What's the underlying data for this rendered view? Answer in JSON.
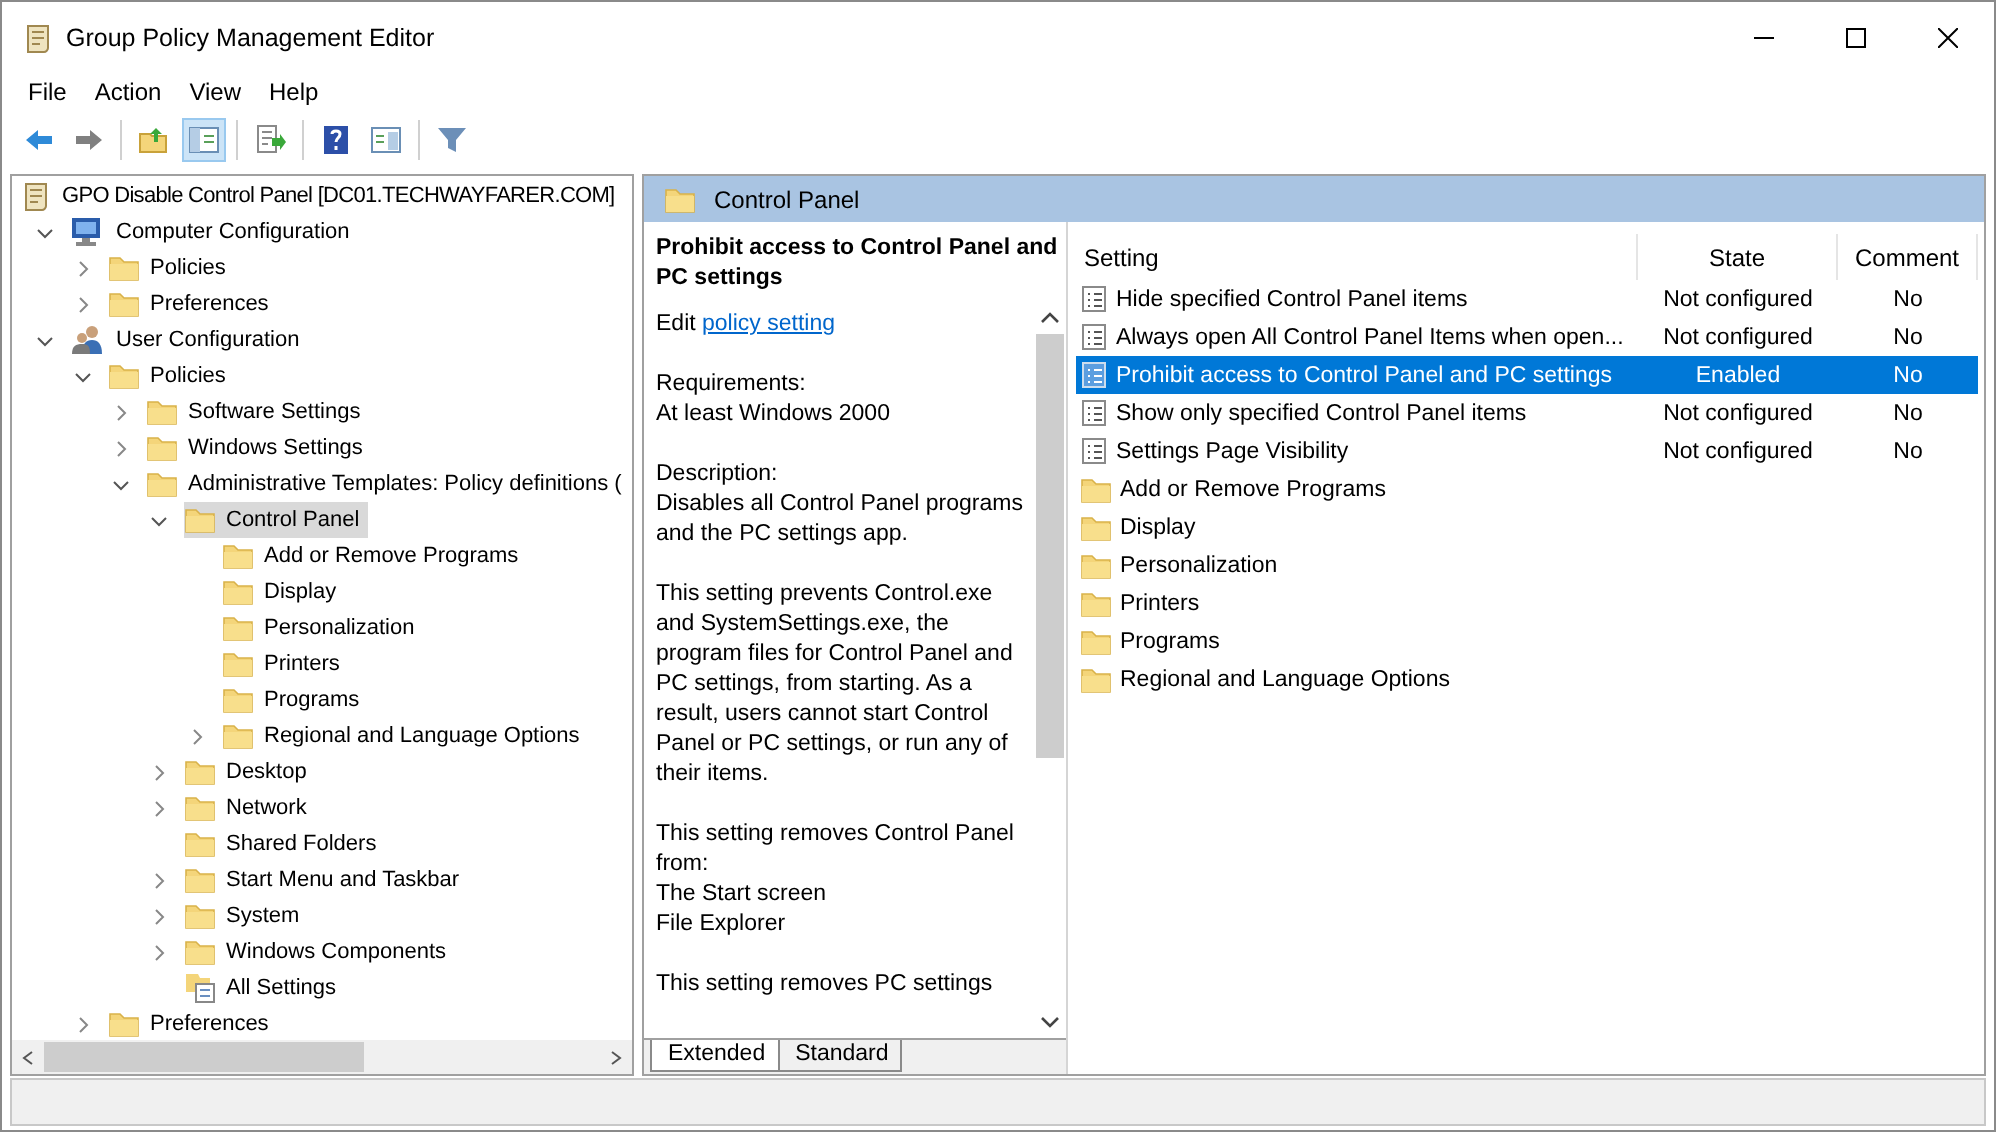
{
  "window": {
    "title": "Group Policy Management Editor"
  },
  "menu": [
    "File",
    "Action",
    "View",
    "Help"
  ],
  "toolbar": [
    {
      "kind": "back",
      "pressed": false
    },
    {
      "kind": "forward",
      "pressed": false
    },
    {
      "kind": "separator"
    },
    {
      "kind": "up",
      "pressed": false
    },
    {
      "kind": "tree",
      "pressed": true
    },
    {
      "kind": "separator"
    },
    {
      "kind": "export",
      "pressed": false
    },
    {
      "kind": "separator"
    },
    {
      "kind": "help",
      "pressed": false
    },
    {
      "kind": "view",
      "pressed": false
    },
    {
      "kind": "separator"
    },
    {
      "kind": "filter",
      "pressed": false
    }
  ],
  "tree": [
    {
      "label": "GPO Disable Control Panel [DC01.TECHWAYFARER.COM]",
      "kind": "gpo",
      "selected": false,
      "children": [
        {
          "label": "Computer Configuration",
          "kind": "computer",
          "expanded": true,
          "selected": false,
          "children": [
            {
              "label": "Policies",
              "kind": "folder",
              "expanded": false,
              "selected": false
            },
            {
              "label": "Preferences",
              "kind": "folder",
              "expanded": false,
              "selected": false
            }
          ]
        },
        {
          "label": "User Configuration",
          "kind": "users",
          "expanded": true,
          "selected": false,
          "children": [
            {
              "label": "Policies",
              "kind": "folder",
              "expanded": true,
              "selected": false,
              "children": [
                {
                  "label": "Software Settings",
                  "kind": "folder",
                  "expanded": false,
                  "selected": false
                },
                {
                  "label": "Windows Settings",
                  "kind": "folder",
                  "expanded": false,
                  "selected": false
                },
                {
                  "label": "Administrative Templates: Policy definitions (",
                  "kind": "folder",
                  "expanded": true,
                  "selected": false,
                  "children": [
                    {
                      "label": "Control Panel",
                      "kind": "folder",
                      "expanded": true,
                      "selected": true,
                      "children": [
                        {
                          "label": "Add or Remove Programs",
                          "kind": "folder",
                          "selected": false
                        },
                        {
                          "label": "Display",
                          "kind": "folder",
                          "selected": false
                        },
                        {
                          "label": "Personalization",
                          "kind": "folder",
                          "selected": false
                        },
                        {
                          "label": "Printers",
                          "kind": "folder",
                          "selected": false
                        },
                        {
                          "label": "Programs",
                          "kind": "folder",
                          "selected": false
                        },
                        {
                          "label": "Regional and Language Options",
                          "kind": "folder",
                          "expanded": false,
                          "selected": false
                        }
                      ]
                    },
                    {
                      "label": "Desktop",
                      "kind": "folder",
                      "expanded": false,
                      "selected": false
                    },
                    {
                      "label": "Network",
                      "kind": "folder",
                      "expanded": false,
                      "selected": false
                    },
                    {
                      "label": "Shared Folders",
                      "kind": "folder",
                      "selected": false
                    },
                    {
                      "label": "Start Menu and Taskbar",
                      "kind": "folder",
                      "expanded": false,
                      "selected": false
                    },
                    {
                      "label": "System",
                      "kind": "folder",
                      "expanded": false,
                      "selected": false
                    },
                    {
                      "label": "Windows Components",
                      "kind": "folder",
                      "expanded": false,
                      "selected": false
                    },
                    {
                      "label": "All Settings",
                      "kind": "settings",
                      "selected": false
                    }
                  ]
                }
              ]
            },
            {
              "label": "Preferences",
              "kind": "folder",
              "expanded": false,
              "selected": false
            }
          ]
        }
      ]
    }
  ],
  "details": {
    "header": "Control Panel",
    "title": "Prohibit access to Control Panel and PC settings",
    "edit_prefix": "Edit ",
    "edit_link": "policy setting",
    "paragraphs": [
      [
        "Requirements:",
        "At least Windows 2000"
      ],
      [
        "Description:",
        "Disables all Control Panel programs and the PC settings app."
      ],
      [
        "This setting prevents Control.exe and SystemSettings.exe, the program files for Control Panel and PC settings, from starting. As a result, users cannot start Control Panel or PC settings, or run any of their items."
      ],
      [
        "This setting removes Control Panel from:",
        "The Start screen",
        "File Explorer"
      ],
      [
        "This setting removes PC settings"
      ]
    ],
    "tabs": [
      {
        "label": "Extended",
        "selected": true
      },
      {
        "label": "Standard",
        "selected": false
      }
    ]
  },
  "table": {
    "columns": [
      "Setting",
      "State",
      "Comment"
    ],
    "rows": [
      {
        "kind": "setting",
        "name": "Hide specified Control Panel items",
        "state": "Not configured",
        "comment": "No",
        "selected": false
      },
      {
        "kind": "setting",
        "name": "Always open All Control Panel Items when open...",
        "state": "Not configured",
        "comment": "No",
        "selected": false
      },
      {
        "kind": "setting",
        "name": "Prohibit access to Control Panel and PC settings",
        "state": "Enabled",
        "comment": "No",
        "selected": true
      },
      {
        "kind": "setting",
        "name": "Show only specified Control Panel items",
        "state": "Not configured",
        "comment": "No",
        "selected": false
      },
      {
        "kind": "setting",
        "name": "Settings Page Visibility",
        "state": "Not configured",
        "comment": "No",
        "selected": false
      },
      {
        "kind": "folder",
        "name": "Add or Remove Programs",
        "selected": false
      },
      {
        "kind": "folder",
        "name": "Display",
        "selected": false
      },
      {
        "kind": "folder",
        "name": "Personalization",
        "selected": false
      },
      {
        "kind": "folder",
        "name": "Printers",
        "selected": false
      },
      {
        "kind": "folder",
        "name": "Programs",
        "selected": false
      },
      {
        "kind": "folder",
        "name": "Regional and Language Options",
        "selected": false
      }
    ]
  }
}
